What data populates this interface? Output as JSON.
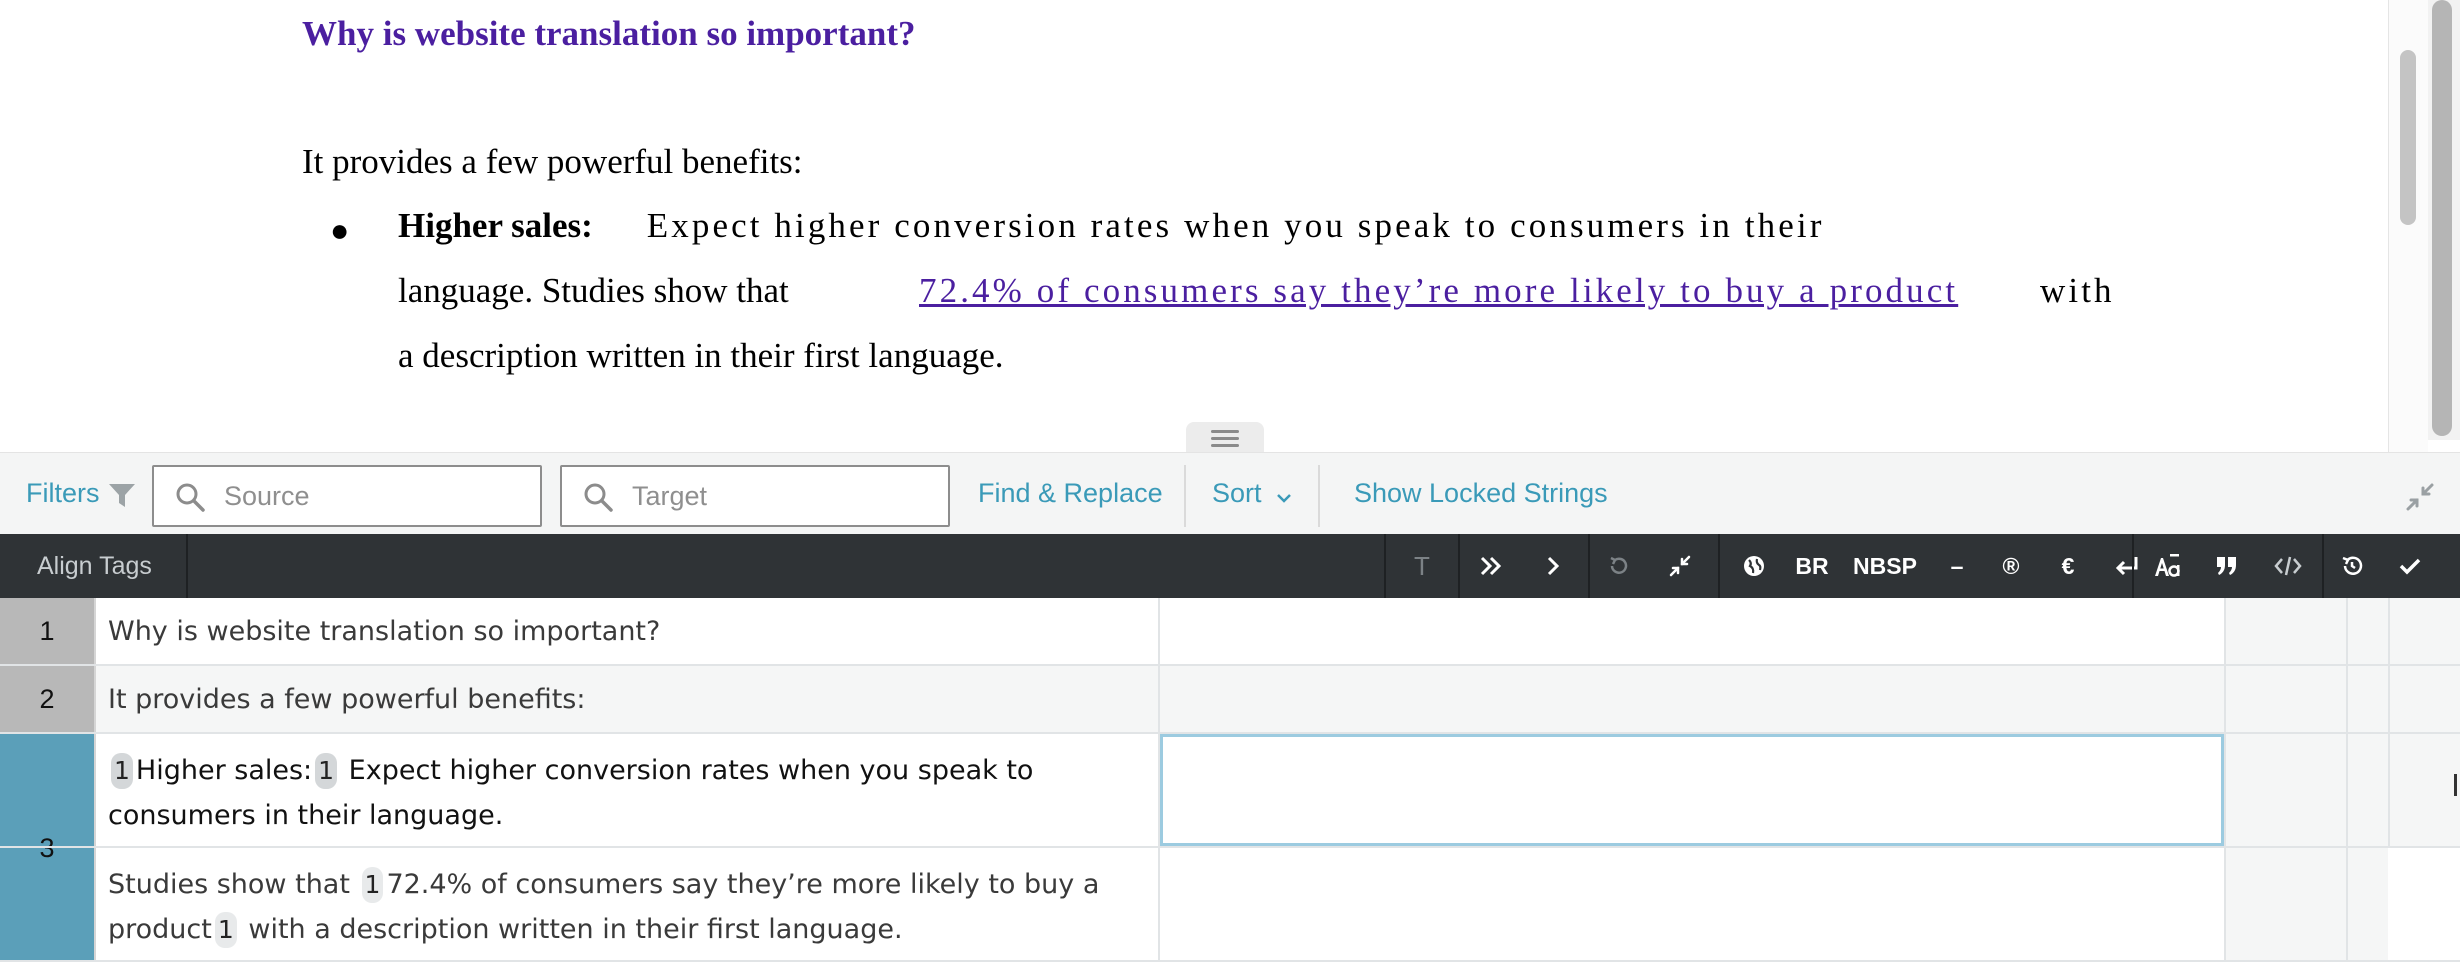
{
  "preview": {
    "title": "Why is website translation so important?",
    "intro": "It provides a few powerful benefits:",
    "bullet_symbol": "●",
    "bullet_bold": "Higher sales:",
    "bullet_line1": "Expect higher conversion rates when you speak to consumers in their",
    "bullet_line2": "language. Studies show that",
    "bullet_link": "72.4% of consumers say they’re more likely to buy a product",
    "bullet_line2_tail": "with",
    "bullet_line3": "a description written in their first language."
  },
  "filterbar": {
    "filters_label": "Filters",
    "source_placeholder": "Source",
    "target_placeholder": "Target",
    "find_replace_label": "Find & Replace",
    "sort_label": "Sort",
    "show_locked_label": "Show Locked Strings"
  },
  "toolbar": {
    "align_tags_label": "Align Tags",
    "text_btn": "T",
    "br_label": "BR",
    "nbsp_label": "NBSP",
    "dash_label": "–",
    "registered_label": "®",
    "euro_label": "€"
  },
  "rows": [
    {
      "num": "1",
      "source": "Why is website translation so important?"
    },
    {
      "num": "2",
      "source": "It provides a few powerful benefits:"
    },
    {
      "num": "3",
      "seg1": {
        "tag_open": "1",
        "bold_text": "Higher sales:",
        "tag_close": "1",
        "text": "Expect higher conversion rates when you speak to consumers in their language."
      },
      "seg2": {
        "text_before": "Studies show that",
        "tag_open": "1",
        "link_text": "72.4% of consumers say they’re more likely to buy a product",
        "tag_close": "1",
        "text_after": "with a description written in their first language."
      }
    }
  ]
}
